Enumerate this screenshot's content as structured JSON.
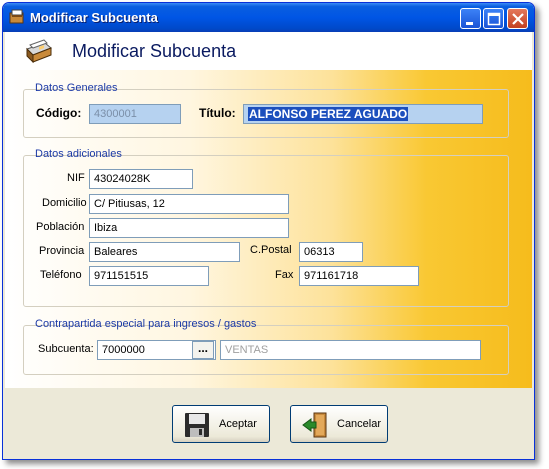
{
  "window": {
    "title": "Modificar Subcuenta",
    "header_title": "Modificar Subcuenta",
    "icons": [
      "app-icon",
      "card-file-icon",
      "minimize-icon",
      "maximize-icon",
      "close-icon"
    ]
  },
  "datos_generales": {
    "label": "Datos Generales",
    "codigo_label": "Código:",
    "codigo_value": "4300001",
    "titulo_label": "Título:",
    "titulo_value": "ALFONSO PEREZ AGUADO"
  },
  "datos_adicionales": {
    "label": "Datos adicionales",
    "nif_label": "NIF",
    "nif_value": "43024028K",
    "domicilio_label": "Domicilio",
    "domicilio_value": "C/ Pitiusas, 12",
    "poblacion_label": "Población",
    "poblacion_value": "Ibiza",
    "provincia_label": "Provincia",
    "provincia_value": "Baleares",
    "cpostal_label": "C.Postal",
    "cpostal_value": "06313",
    "telefono_label": "Teléfono",
    "telefono_value": "971151515",
    "fax_label": "Fax",
    "fax_value": "971161718"
  },
  "contrapartida": {
    "label": "Contrapartida especial para ingresos / gastos",
    "subcuenta_label": "Subcuenta:",
    "subcuenta_value": "7000000",
    "lookup_label": "...",
    "descripcion_value": "VENTAS"
  },
  "buttons": {
    "aceptar": "Aceptar",
    "cancelar": "Cancelar"
  },
  "colors": {
    "titlebar": "#0055e5",
    "accent_gradient_end": "#f6bc1c",
    "selection": "#1c4fbd"
  }
}
